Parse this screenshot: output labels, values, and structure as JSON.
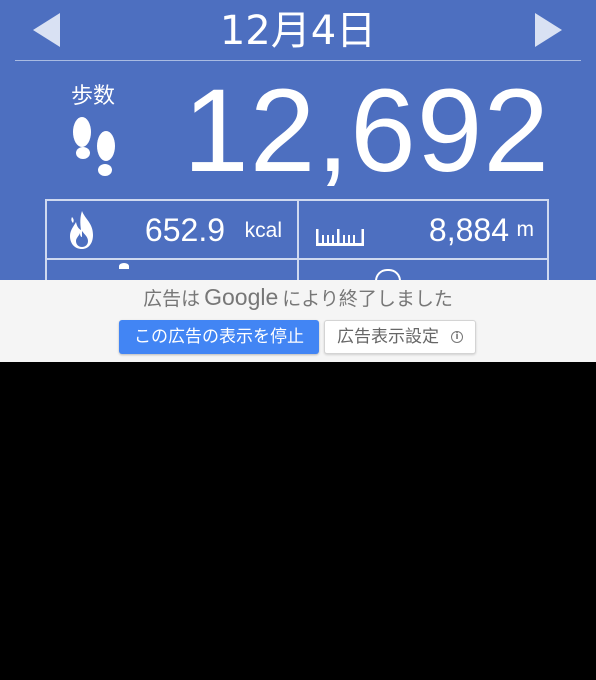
{
  "header": {
    "date": "12月4日",
    "prev_icon": "triangle-left-icon",
    "next_icon": "triangle-right-icon"
  },
  "steps": {
    "label": "歩数",
    "value": "12,692",
    "icon": "footprints-icon"
  },
  "stats": {
    "calories": {
      "value": "652.9",
      "unit": "kcal",
      "icon": "fire-icon"
    },
    "distance": {
      "value": "8,884",
      "unit": "m",
      "icon": "ruler-icon"
    }
  },
  "ad": {
    "message_prefix": "広告は",
    "brand": "Google",
    "message_suffix": "により終了しました",
    "stop_button": "この広告の表示を停止",
    "settings_button": "広告表示設定",
    "settings_icon": "info-icon"
  },
  "colors": {
    "app_background": "#4d6fc0",
    "ad_panel_background": "#f5f5f5",
    "stop_button": "#4285f4"
  }
}
